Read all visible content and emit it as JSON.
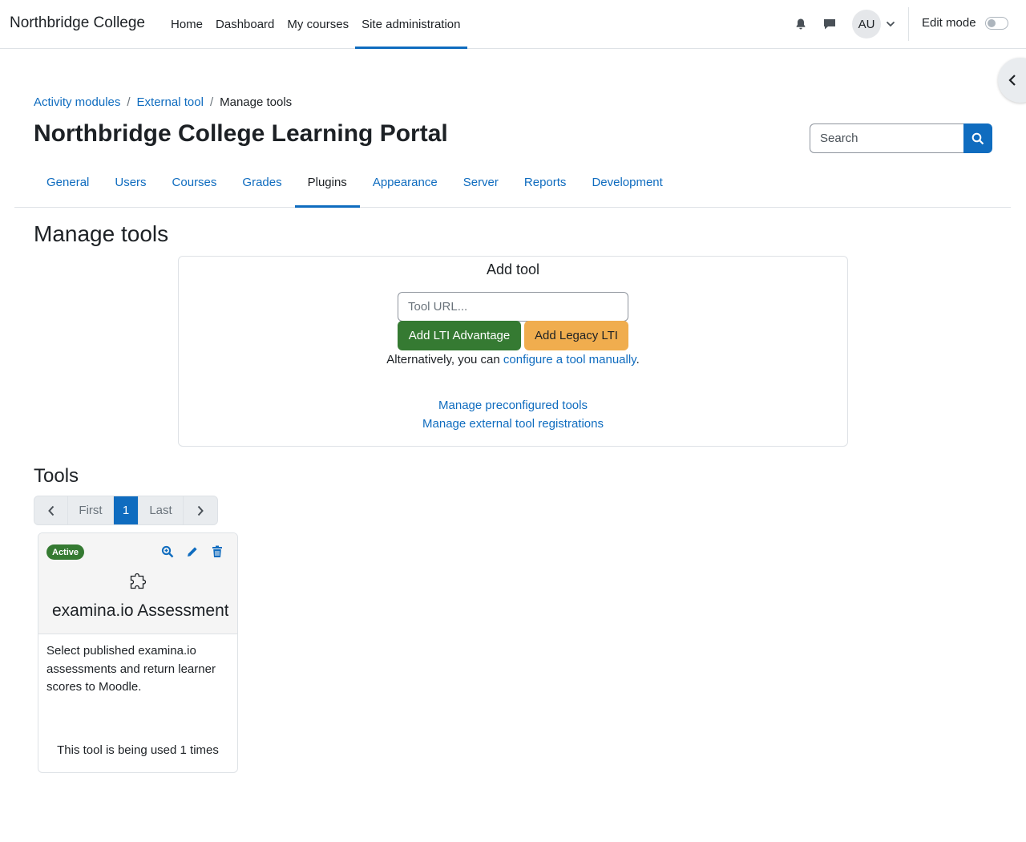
{
  "navbar": {
    "brand": "Northbridge College",
    "items": [
      "Home",
      "Dashboard",
      "My courses",
      "Site administration"
    ],
    "avatar_initials": "AU",
    "edit_mode_label": "Edit mode"
  },
  "breadcrumb": [
    "Activity modules",
    "External tool",
    "Manage tools"
  ],
  "page_title": "Northbridge College Learning Portal",
  "search": {
    "placeholder": "Search"
  },
  "tabs": [
    "General",
    "Users",
    "Courses",
    "Grades",
    "Plugins",
    "Appearance",
    "Server",
    "Reports",
    "Development"
  ],
  "section_heading": "Manage tools",
  "add_tool": {
    "title": "Add tool",
    "url_placeholder": "Tool URL...",
    "advantage_button": "Add LTI Advantage",
    "legacy_button": "Add Legacy LTI",
    "alt_prefix": "Alternatively, you can ",
    "alt_link": "configure a tool manually",
    "alt_suffix": ".",
    "preconfigured_link": "Manage preconfigured tools",
    "registrations_link": "Manage external tool registrations"
  },
  "tools_heading": "Tools",
  "pagination": {
    "first": "First",
    "current": "1",
    "last": "Last"
  },
  "tool_card": {
    "status": "Active",
    "name": "examina.io Assessments",
    "description": "Select published examina.io assessments and return learner scores to Moodle.",
    "usage": "This tool is being used 1 times"
  },
  "colors": {
    "primary": "#0f6cbf",
    "success": "#357a32",
    "warning": "#f0ad4e"
  }
}
